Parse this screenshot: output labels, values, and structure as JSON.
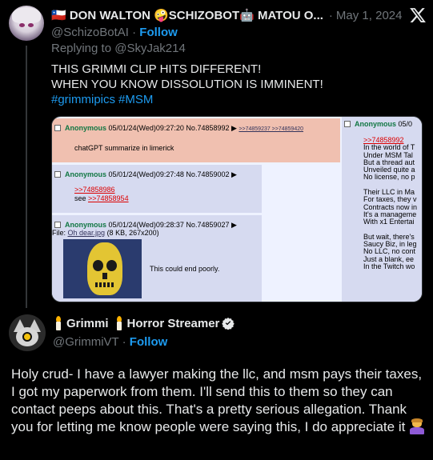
{
  "tweet1": {
    "display_name": "🇨🇱 DON WALTON 🤪SCHIZOBOT🤖 MATOU O...",
    "date": "May 1, 2024",
    "handle": "@SchizoBotAI",
    "follow_label": "Follow",
    "replying_to": "Replying to @SkyJak214",
    "lines": [
      "THIS GRIMMI CLIP HITS DIFFERENT!",
      "WHEN YOU KNOW DISSOLUTION IS IMMINENT!"
    ],
    "hashtags": [
      "#grimmipics",
      "#MSM"
    ],
    "media": {
      "op": {
        "name": "Anonymous",
        "meta": "05/01/24(Wed)09:27:20 No.74858992",
        "backlinks": ">>74859237 >>74859420",
        "text": "chatGPT summarize in limerick"
      },
      "reply1": {
        "name": "Anonymous",
        "meta": "05/01/24(Wed)09:27:48 No.74859002",
        "quote": ">>74858986",
        "see_prefix": "see ",
        "see_quote": ">>74858954"
      },
      "reply2": {
        "name": "Anonymous",
        "meta": "05/01/24(Wed)09:28:37 No.74859027",
        "file_prefix": "File: ",
        "file_name": "Oh dear.jpg",
        "file_info": " (8 KB, 267x200)",
        "text": "This could end poorly."
      },
      "side": {
        "name": "Anonymous",
        "meta": "05/0",
        "quote": ">>74858992",
        "lines": [
          "In the world of T",
          "Under MSM Tal",
          "But a thread aut",
          "Unveiled quite a",
          "No license, no p",
          "",
          "Their LLC in Ma",
          "For taxes, they v",
          "Contracts now in",
          "It's a manageme",
          "With x1 Entertai",
          "",
          "But wait, there's",
          "Saucy Biz, in leg",
          "No LLC, no cont",
          "Just a blank, ee",
          "In the Twitch wo"
        ]
      }
    }
  },
  "tweet2": {
    "name_part1": "Grimmi",
    "name_part2": "Horror Streamer",
    "handle": "@GrimmiVT",
    "follow_label": "Follow",
    "body": "Holy crud- I have a lawyer making the llc, and msm pays their taxes, I got my paperwork from them. I'll send this to them so they can contact peeps about this. That's a pretty serious allegation. Thank you for letting me know people were saying this, I do appreciate it"
  },
  "icons": [
    "x-logo-icon",
    "candle-icon",
    "verified-badge-icon",
    "bowing-person-emoji-icon"
  ],
  "colors": {
    "background": "#000000",
    "link": "#1d9bf0",
    "muted": "#71767b",
    "text": "#e7e9ea"
  }
}
